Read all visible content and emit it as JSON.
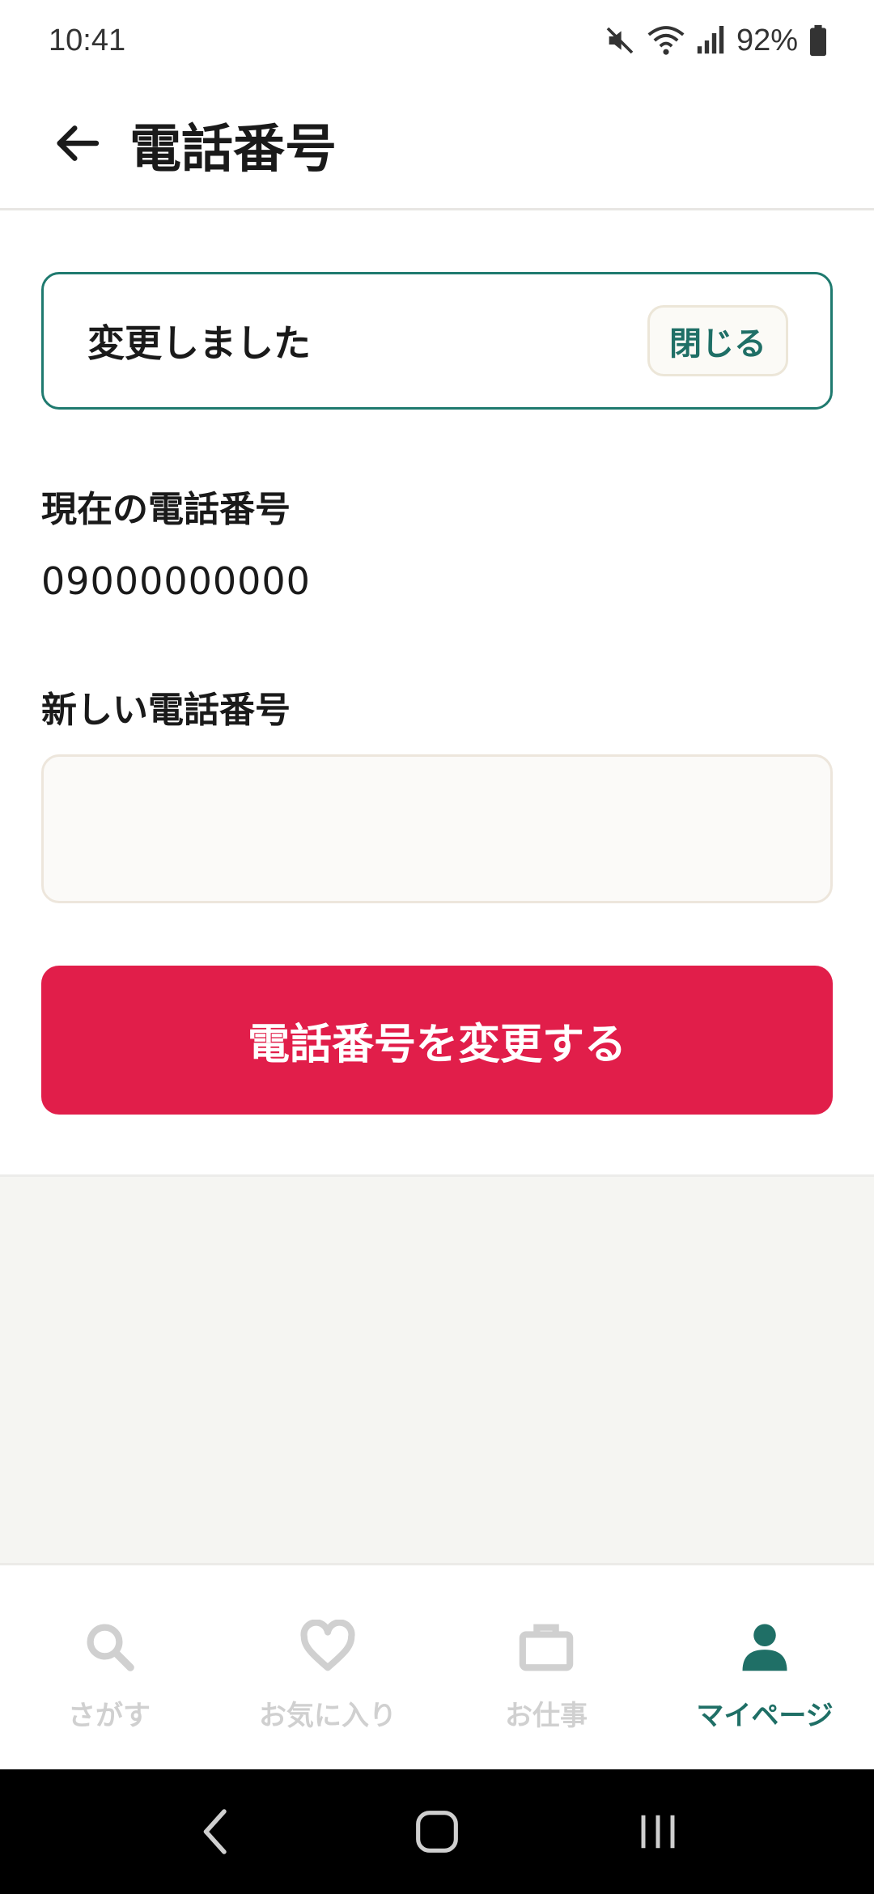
{
  "status_bar": {
    "time": "10:41",
    "battery": "92%",
    "icons": [
      "mute-icon",
      "wifi-icon",
      "signal-icon",
      "battery-icon"
    ]
  },
  "header": {
    "title": "電話番号",
    "back_icon": "arrow-left-icon"
  },
  "toast": {
    "message": "変更しました",
    "close_label": "閉じる",
    "border_color": "#1f7a6f"
  },
  "form": {
    "current_label": "現在の電話番号",
    "current_value": "09000000000",
    "new_label": "新しい電話番号",
    "new_value": "",
    "new_placeholder": "",
    "submit_label": "電話番号を変更する",
    "submit_color": "#e11e4a"
  },
  "tabs": [
    {
      "label": "さがす",
      "icon": "search-icon",
      "active": false
    },
    {
      "label": "お気に入り",
      "icon": "heart-icon",
      "active": false
    },
    {
      "label": "お仕事",
      "icon": "briefcase-icon",
      "active": false
    },
    {
      "label": "マイページ",
      "icon": "person-icon",
      "active": true
    }
  ],
  "colors": {
    "accent": "#1f6f66",
    "inactive_tab": "#d0d0d0"
  },
  "system_nav": [
    "back-nav-icon",
    "home-nav-icon",
    "recents-nav-icon"
  ]
}
